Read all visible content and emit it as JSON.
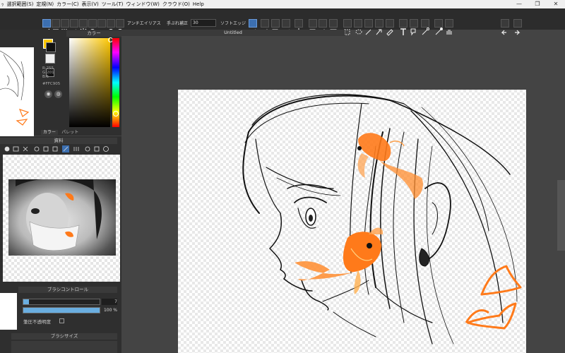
{
  "menu": [
    "ｯ",
    "選択範囲(S)",
    "定規(N)",
    "カラー(C)",
    "表示(V)",
    "ツール(T)",
    "ウィンドウ(W)",
    "クラウド(O)",
    "Help"
  ],
  "window_controls": [
    "—",
    "❐",
    "✕"
  ],
  "toolbar": {
    "antialias_label": "アンチエイリアス",
    "stabilizer_label": "手ぶれ補正",
    "stabilizer_value": "30",
    "soft_edge_label": "ソフトエッジ"
  },
  "document": {
    "title": "Untitled"
  },
  "color_panel": {
    "title": "カラー",
    "r": "R:255",
    "g": "G:201",
    "b": "B:5",
    "hex": "#FFC905",
    "tab_color": "カラー",
    "tab_palette": "パレット",
    "main_color": "#FFC905",
    "sub_color": "#111111"
  },
  "material_panel": {
    "title": "資料"
  },
  "brush_control": {
    "title": "ブラシコントロール",
    "size_value": "7",
    "size_fraction": 0.07,
    "opacity_value": "100 %",
    "opacity_fraction": 1.0,
    "pressure_opacity_label": "筆圧不透明度"
  },
  "brush_size_panel": {
    "title": "ブラシサイズ"
  },
  "accent_orange": "#FF7A1A"
}
